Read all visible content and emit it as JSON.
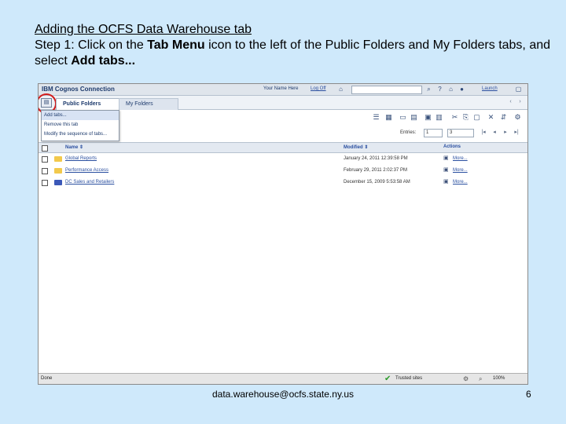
{
  "slide": {
    "title_underlined": "Adding the OCFS Data Warehouse tab",
    "step_prefix": "Step 1: Click on the ",
    "step_bold1": "Tab Menu",
    "step_middle": " icon to the left of the Public Folders and My Folders tabs, and select ",
    "step_bold2": "Add tabs...",
    "footer_email": "data.warehouse@ocfs.state.ny.us",
    "page_number": "6"
  },
  "app": {
    "brand": "IBM Cognos Connection",
    "username": "Your Name Here",
    "logoff": "Log Off",
    "launch": "Launch"
  },
  "tabs": {
    "tab_menu_icon": "tab-menu-icon",
    "public_folders": "Public Folders",
    "my_folders": "My Folders"
  },
  "tab_menu": {
    "items": [
      "Add tabs...",
      "Remove this tab",
      "Modify the sequence of tabs..."
    ]
  },
  "toolbar": {
    "entries_label": "Entries:",
    "entries_from": "1",
    "entries_to": "3"
  },
  "table": {
    "col_name": "Name ⇕",
    "col_modified": "Modified ⇕",
    "col_actions": "Actions",
    "rows": [
      {
        "name": "Global Reports",
        "modified": "January 24, 2011 12:39:58 PM",
        "more": "More..."
      },
      {
        "name": "Performance Access",
        "modified": "February 29, 2011 2:02:37 PM",
        "more": "More..."
      },
      {
        "name": "DC Sales and Retailers",
        "modified": "December 15, 2009 5:53:58 AM",
        "more": "More..."
      }
    ]
  },
  "statusbar": {
    "left": "Done",
    "trusted": "Trusted sites",
    "zoom": "100%"
  },
  "colors": {
    "slide_background": "#cfe9fb",
    "highlight_ring": "#d21c1c"
  }
}
